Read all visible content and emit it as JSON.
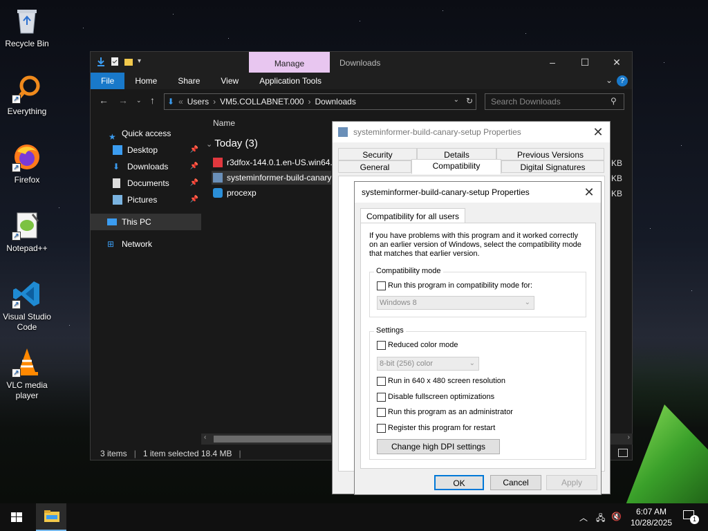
{
  "desktop": {
    "icons": [
      {
        "label": "Recycle Bin"
      },
      {
        "label": "Everything"
      },
      {
        "label": "Firefox"
      },
      {
        "label": "Notepad++"
      },
      {
        "label": "Visual Studio Code"
      },
      {
        "label": "VLC media player"
      }
    ]
  },
  "explorer": {
    "context_tab": "Manage",
    "title": "Downloads",
    "ribbon": [
      "File",
      "Home",
      "Share",
      "View",
      "Application Tools"
    ],
    "breadcrumb": [
      "Users",
      "VM5.COLLABNET.000",
      "Downloads"
    ],
    "search_placeholder": "Search Downloads",
    "nav": {
      "quick_access": "Quick access",
      "items": [
        "Desktop",
        "Downloads",
        "Documents",
        "Pictures"
      ],
      "this_pc": "This PC",
      "network": "Network"
    },
    "column_name": "Name",
    "group": "Today (3)",
    "files": [
      {
        "name": "r3dfox-144.0.1.en-US.win64.i",
        "size_suffix": "KB"
      },
      {
        "name": "systeminformer-build-canary",
        "size_suffix": "KB"
      },
      {
        "name": "procexp",
        "size_suffix": "KB"
      }
    ],
    "status": {
      "count": "3 items",
      "selection": "1 item selected  18.4 MB"
    }
  },
  "back_dialog": {
    "title": "systeminformer-build-canary-setup Properties",
    "tabs_row1": [
      "Security",
      "Details",
      "Previous Versions"
    ],
    "tabs_row2": [
      "General",
      "Compatibility",
      "Digital Signatures"
    ]
  },
  "front_dialog": {
    "title": "systeminformer-build-canary-setup Properties",
    "tab": "Compatibility for all users",
    "intro": "If you have problems with this program and it worked correctly on an earlier version of Windows, select the compatibility mode that matches that earlier version.",
    "compat_group": "Compatibility mode",
    "compat_checkbox": "Run this program in compatibility mode for:",
    "compat_value": "Windows 8",
    "settings_group": "Settings",
    "reduced_color": "Reduced color mode",
    "color_value": "8-bit (256) color",
    "opt_640": "Run in 640 x 480 screen resolution",
    "opt_fullscreen": "Disable fullscreen optimizations",
    "opt_admin": "Run this program as an administrator",
    "opt_restart": "Register this program for restart",
    "dpi_button": "Change high DPI settings",
    "ok": "OK",
    "cancel": "Cancel",
    "apply": "Apply"
  },
  "taskbar": {
    "time": "6:07 AM",
    "date": "10/28/2025",
    "notification_count": "1"
  },
  "colors": {
    "accent": "#1979ca",
    "manage_tab": "#e8c6f0",
    "focus": "#0078d7"
  }
}
